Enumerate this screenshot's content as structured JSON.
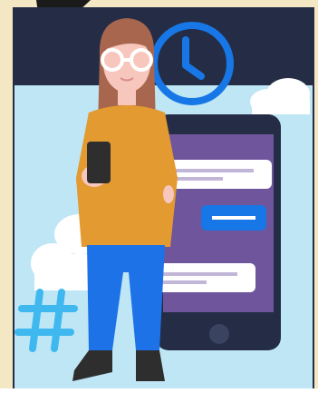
{
  "illustration": {
    "colors": {
      "navy": "#242d45",
      "sky": "#bfe6f5",
      "cream": "#f3e7c4",
      "cloud": "#ffffff",
      "accent_blue": "#1877e6",
      "hashtag": "#3fb8f0",
      "phone_screen": "#6f559c",
      "shirt": "#e29a31",
      "jeans": "#1d72e8",
      "hair": "#a8664f",
      "skin": "#f7c6bd",
      "glasses": "#ffffff",
      "bubble_line": "#c2b6d8",
      "shoe": "#2e2e2e"
    },
    "icons": [
      "clock-icon",
      "hashtag-icon",
      "smartphone-icon"
    ],
    "message_bubbles": [
      {
        "side": "incoming"
      },
      {
        "side": "outgoing"
      },
      {
        "side": "incoming"
      }
    ]
  }
}
